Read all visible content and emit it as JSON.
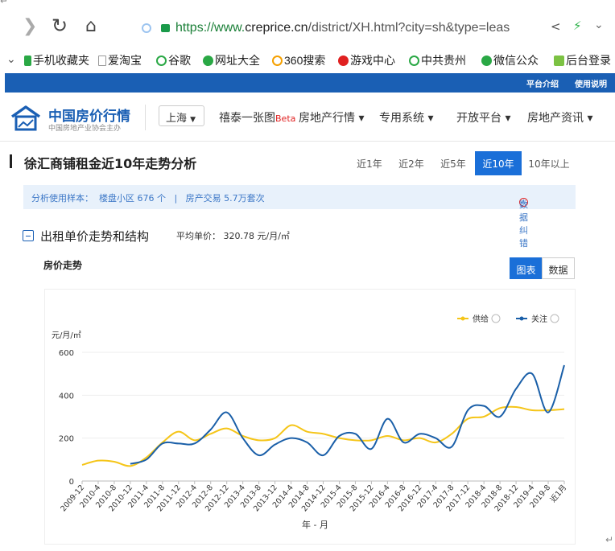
{
  "browser": {
    "url_protocol": "https://www.",
    "url_domain": "creprice.cn",
    "url_rest": "/district/XH.html?city=sh&type=leas",
    "back_icon": "back-icon",
    "refresh_icon": "refresh-icon",
    "home_icon": "home-icon"
  },
  "bookmarks": [
    "手机收藏夹",
    "爱淘宝",
    "谷歌",
    "网址大全",
    "360搜索",
    "游戏中心",
    "中共贵州",
    "微信公众",
    "后台登录"
  ],
  "topbar": {
    "links": [
      "平台介绍",
      "使用说明"
    ]
  },
  "header": {
    "logo_title": "中国房价行情",
    "logo_subtitle": "中国房地产业协会主办",
    "city": "上海",
    "nav": [
      "禧泰一张图",
      "房地产行情",
      "专用系统",
      "开放平台",
      "房地产资讯"
    ],
    "beta": "Beta"
  },
  "section": {
    "title": "徐汇商铺租金近10年走势分析",
    "ranges": [
      "近1年",
      "近2年",
      "近5年",
      "近10年",
      "10年以上"
    ],
    "active_range": "近10年",
    "sample_text": "分析使用样本：  楼盘小区 676 个   |   房产交易 5.7万套次",
    "error_text": "数据纠错",
    "subtitle": "出租单价走势和结构",
    "avg_label": "平均单价：",
    "avg_value": "320.78 元/月/㎡",
    "chart_title": "房价走势",
    "toggle": [
      "图表",
      "数据"
    ]
  },
  "colors": {
    "supply": "#f5c518",
    "attention": "#1a5fa8",
    "accent": "#1a6fd8"
  },
  "chart_data": {
    "type": "line",
    "ylabel": "元/月/㎡",
    "xlabel": "年 - 月",
    "ylim": [
      0,
      600
    ],
    "yticks": [
      0,
      200,
      400,
      600
    ],
    "x": [
      "2009-12",
      "2010-4",
      "2010-8",
      "2010-12",
      "2011-4",
      "2011-8",
      "2011-12",
      "2012-4",
      "2012-8",
      "2012-12",
      "2013-4",
      "2013-8",
      "2013-12",
      "2014-4",
      "2014-8",
      "2014-12",
      "2015-4",
      "2015-8",
      "2015-12",
      "2016-4",
      "2016-8",
      "2016-12",
      "2017-4",
      "2017-8",
      "2017-12",
      "2018-4",
      "2018-8",
      "2018-12",
      "2019-4",
      "2019-8",
      "近1月"
    ],
    "series": [
      {
        "name": "供给",
        "color": "#f5c518",
        "values": [
          75,
          95,
          90,
          70,
          110,
          180,
          230,
          190,
          220,
          245,
          210,
          190,
          200,
          260,
          230,
          220,
          200,
          190,
          190,
          210,
          190,
          200,
          180,
          220,
          290,
          300,
          340,
          345,
          330,
          330,
          335
        ]
      },
      {
        "name": "关注",
        "color": "#1a5fa8",
        "values": [
          null,
          null,
          null,
          80,
          100,
          175,
          175,
          175,
          240,
          320,
          200,
          120,
          170,
          200,
          180,
          120,
          210,
          220,
          150,
          290,
          180,
          220,
          200,
          160,
          330,
          350,
          300,
          430,
          500,
          320,
          540
        ]
      }
    ]
  }
}
